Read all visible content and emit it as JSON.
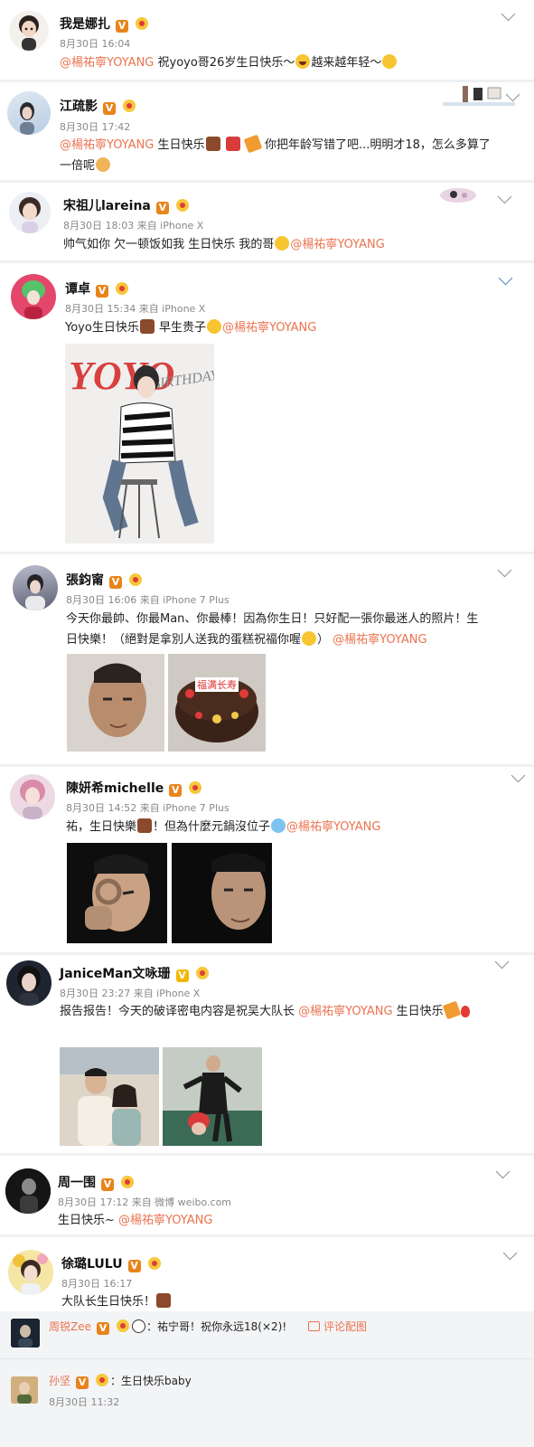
{
  "mention_handle": "@楊祐寧YOYANG",
  "posts": [
    {
      "name": "我是娜扎",
      "meta": "8月30日 16:04",
      "text_after": "祝yoyo哥26岁生日快乐～",
      "text_tail1": "越来越年轻～"
    },
    {
      "name": "江疏影",
      "meta": "8月30日 17:42",
      "text_after": "生日快乐",
      "text_tail1": "你把年龄写错了吧...明明才18，怎么多算了",
      "text_line2": "一倍呢"
    },
    {
      "name": "宋祖儿lareina",
      "meta": "8月30日 18:03 来自 iPhone X",
      "text_before": "帅气如你 欠一顿饭如我 生日快乐 我的哥"
    },
    {
      "name": "谭卓",
      "meta": "8月30日 15:34 来自 iPhone X",
      "text_before": "Yoyo生日快乐",
      "text_mid": "早生贵子",
      "image_text1": "YOYO",
      "image_text2": "BIRTHDAY"
    },
    {
      "name": "張鈞甯",
      "meta": "8月30日 16:06 来自 iPhone 7 Plus",
      "text_line1": "今天你最帥、你最Man、你最棒！因為你生日！只好配一張你最迷人的照片！生",
      "text_line2": "日快樂！（絕對是拿別人送我的蛋糕祝福你喔",
      "text_line2_close": "）",
      "cake_text": "福满长寿"
    },
    {
      "name": "陳妍希michelle",
      "meta": "8月30日 14:52 来自 iPhone 7 Plus",
      "text_before": "祐，生日快樂",
      "text_mid": "！但為什麼元鍋沒位子"
    },
    {
      "name": "JaniceMan文咏珊",
      "meta": "8月30日 23:27 来自 iPhone X",
      "text_before": "报告报告！今天的破译密电内容是祝吴大队长 ",
      "text_after": " 生日快乐"
    },
    {
      "name": "周一围",
      "meta": "8月30日 17:12 来自 微博 weibo.com",
      "text_before": "生日快乐~ "
    },
    {
      "name": "徐璐LULU",
      "meta": "8月30日 16:17",
      "text_before": "大队长生日快乐！"
    }
  ],
  "comments": [
    {
      "name": "周锐Zee",
      "text": "：祐宁哥！祝你永远18(×2)!",
      "link": "评论配图"
    },
    {
      "name": "孙坚",
      "text": "：生日快乐baby",
      "meta": "8月30日 11:32"
    }
  ],
  "badges": {
    "v": "V"
  }
}
